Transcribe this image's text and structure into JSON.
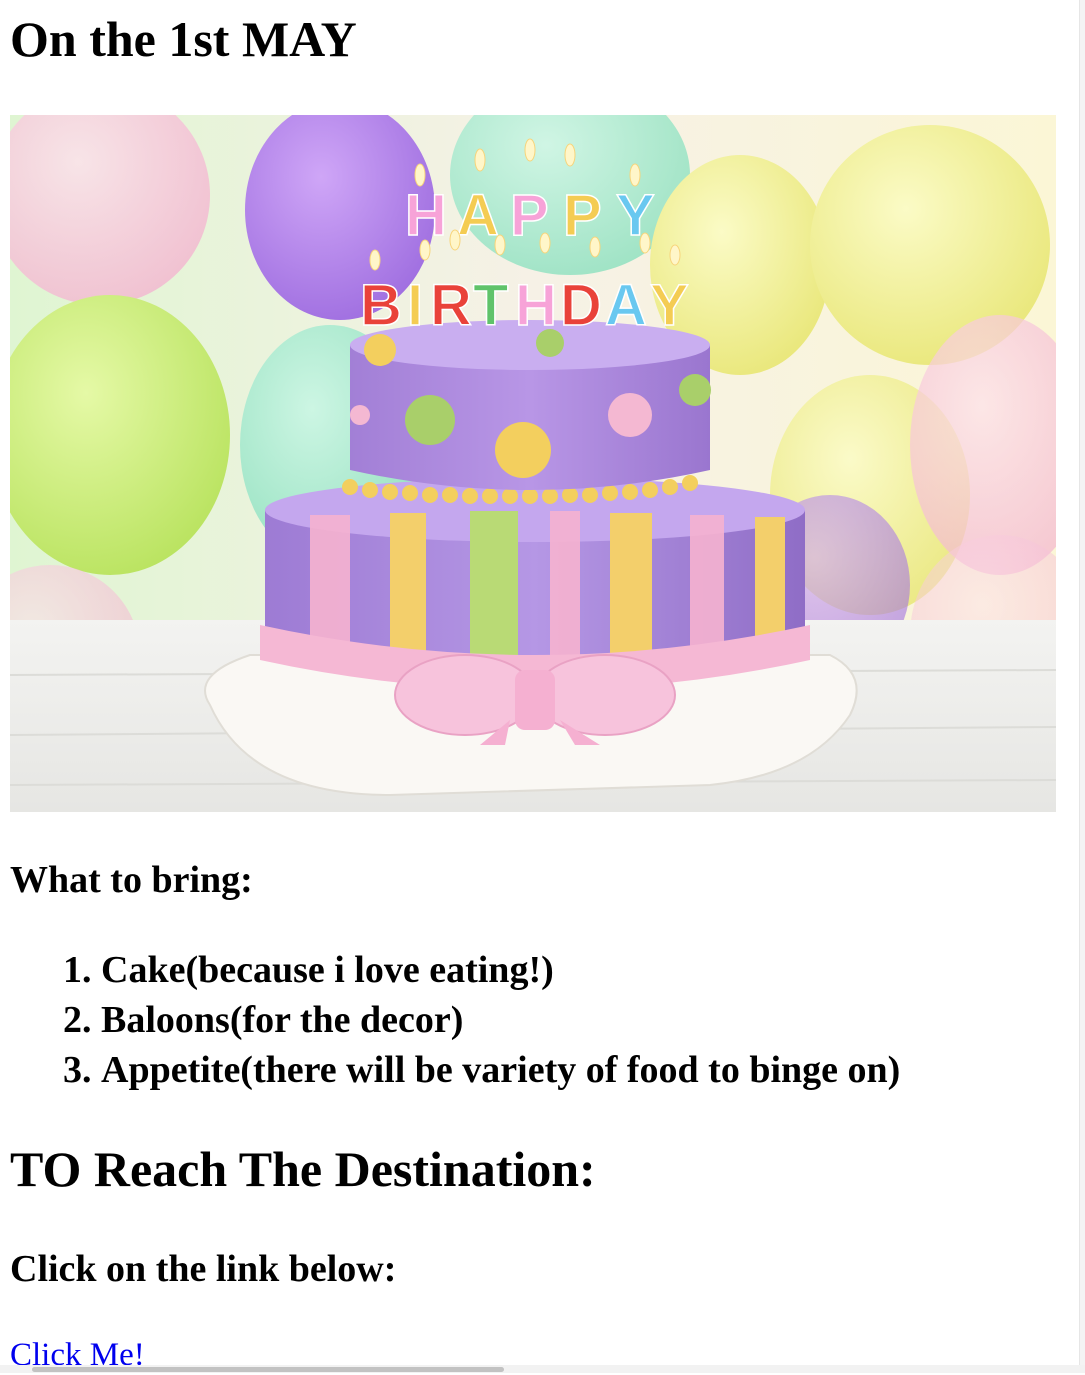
{
  "page": {
    "title": "On the 1st MAY",
    "image": {
      "description_icon": "birthday-cake-image",
      "candle_word_top": "HAPPY",
      "candle_word_bottom": "BIRTHDAY"
    },
    "bring": {
      "heading": "What to bring:",
      "items": [
        "Cake(because i love eating!)",
        "Baloons(for the decor)",
        "Appetite(there will be variety of food to binge on)"
      ]
    },
    "destination": {
      "heading": "TO Reach The Destination:",
      "subheading": "Click on the link below:",
      "link_text": "Click Me!"
    }
  },
  "colors": {
    "link": "#0000ee",
    "text": "#000000",
    "background": "#ffffff"
  }
}
